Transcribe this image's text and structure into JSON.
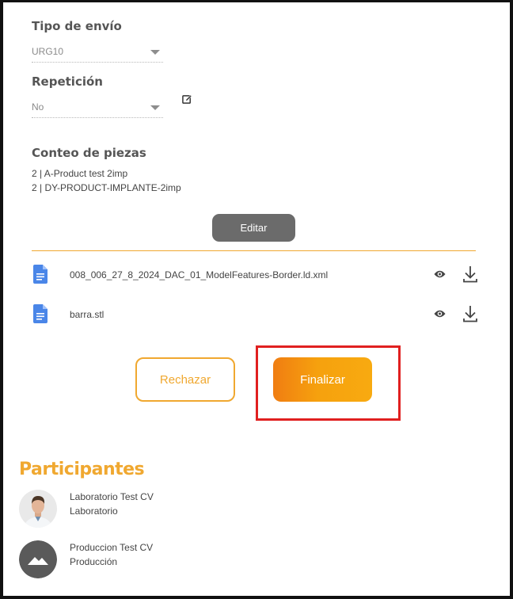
{
  "shipping": {
    "label": "Tipo de envío",
    "value": "URG10"
  },
  "repetition": {
    "label": "Repetición",
    "value": "No"
  },
  "piece_count": {
    "label": "Conteo de piezas",
    "items": [
      "2 | A-Product test 2imp",
      "2 | DY-PRODUCT-IMPLANTE-2imp"
    ]
  },
  "edit_button": "Editar",
  "files": [
    {
      "name": "008_006_27_8_2024_DAC_01_ModelFeatures-Border.ld.xml",
      "icon": "google-doc-icon"
    },
    {
      "name": "barra.stl",
      "icon": "google-doc-icon"
    }
  ],
  "actions": {
    "reject": "Rechazar",
    "finish": "Finalizar"
  },
  "participants": {
    "title": "Participantes",
    "people": [
      {
        "name": "Laboratorio Test CV",
        "role": "Laboratorio",
        "avatar": "photo-avatar"
      },
      {
        "name": "Produccion Test CV",
        "role": "Producción",
        "avatar": "placeholder-image-avatar"
      }
    ]
  },
  "colors": {
    "accent": "#f0a830",
    "finish_gradient_start": "#f07d12",
    "highlight": "#e02020",
    "doc_icon": "#4a86e8"
  }
}
